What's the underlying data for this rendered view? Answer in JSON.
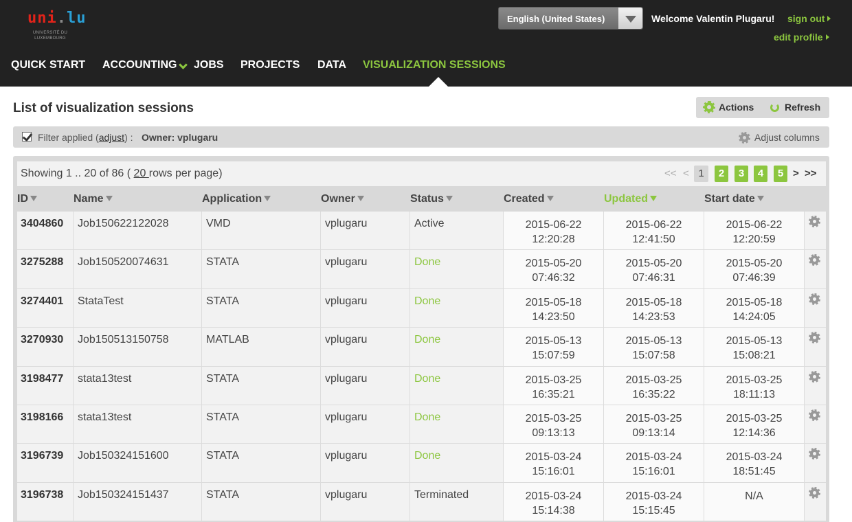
{
  "header": {
    "logo": {
      "word_uni": "uni",
      "word_dot": ".",
      "word_lu": "lu",
      "subtitle": "UNIVERSITÉ DU LUXEMBOURG"
    },
    "language": "English (United States)",
    "welcome": "Welcome Valentin Plugaru!",
    "sign_out": "sign out",
    "edit_profile": "edit profile"
  },
  "nav": {
    "items": [
      "QUICK START",
      "ACCOUNTING",
      "JOBS",
      "PROJECTS",
      "DATA",
      "VISUALIZATION SESSIONS"
    ],
    "active": "VISUALIZATION SESSIONS"
  },
  "page": {
    "title": "List of visualization sessions",
    "actions_label": "Actions",
    "refresh_label": "Refresh"
  },
  "filter": {
    "prefix": "Filter applied (",
    "adjust_link": "adjust",
    "suffix": ") :",
    "owner": "Owner: vplugaru",
    "adjust_columns": "Adjust columns"
  },
  "table": {
    "showing_prefix": "Showing 1 .. 20 of 86 ( ",
    "rows_per_page": "20 ",
    "showing_suffix": "rows per page)",
    "pager": {
      "first": "<<",
      "prev": "<",
      "current": "1",
      "pages": [
        "2",
        "3",
        "4",
        "5"
      ],
      "next": ">",
      "last": ">>"
    },
    "columns": [
      "ID",
      "Name",
      "Application",
      "Owner",
      "Status",
      "Created",
      "Updated",
      "Start date"
    ],
    "sorted_column": "Updated",
    "rows": [
      {
        "id": "3404860",
        "name": "Job150622122028",
        "app": "VMD",
        "owner": "vplugaru",
        "status": "Active",
        "created": [
          "2015-06-22",
          "12:20:28"
        ],
        "updated": [
          "2015-06-22",
          "12:41:50"
        ],
        "start": [
          "2015-06-22",
          "12:20:59"
        ]
      },
      {
        "id": "3275288",
        "name": "Job150520074631",
        "app": "STATA",
        "owner": "vplugaru",
        "status": "Done",
        "created": [
          "2015-05-20",
          "07:46:32"
        ],
        "updated": [
          "2015-05-20",
          "07:46:31"
        ],
        "start": [
          "2015-05-20",
          "07:46:39"
        ]
      },
      {
        "id": "3274401",
        "name": "StataTest",
        "app": "STATA",
        "owner": "vplugaru",
        "status": "Done",
        "created": [
          "2015-05-18",
          "14:23:50"
        ],
        "updated": [
          "2015-05-18",
          "14:23:53"
        ],
        "start": [
          "2015-05-18",
          "14:24:05"
        ]
      },
      {
        "id": "3270930",
        "name": "Job150513150758",
        "app": "MATLAB",
        "owner": "vplugaru",
        "status": "Done",
        "created": [
          "2015-05-13",
          "15:07:59"
        ],
        "updated": [
          "2015-05-13",
          "15:07:58"
        ],
        "start": [
          "2015-05-13",
          "15:08:21"
        ]
      },
      {
        "id": "3198477",
        "name": "stata13test",
        "app": "STATA",
        "owner": "vplugaru",
        "status": "Done",
        "created": [
          "2015-03-25",
          "16:35:21"
        ],
        "updated": [
          "2015-03-25",
          "16:35:22"
        ],
        "start": [
          "2015-03-25",
          "18:11:13"
        ]
      },
      {
        "id": "3198166",
        "name": "stata13test",
        "app": "STATA",
        "owner": "vplugaru",
        "status": "Done",
        "created": [
          "2015-03-25",
          "09:13:13"
        ],
        "updated": [
          "2015-03-25",
          "09:13:14"
        ],
        "start": [
          "2015-03-25",
          "12:14:36"
        ]
      },
      {
        "id": "3196739",
        "name": "Job150324151600",
        "app": "STATA",
        "owner": "vplugaru",
        "status": "Done",
        "created": [
          "2015-03-24",
          "15:16:01"
        ],
        "updated": [
          "2015-03-24",
          "15:16:01"
        ],
        "start": [
          "2015-03-24",
          "18:51:45"
        ]
      },
      {
        "id": "3196738",
        "name": "Job150324151437",
        "app": "STATA",
        "owner": "vplugaru",
        "status": "Terminated",
        "created": [
          "2015-03-24",
          "15:14:38"
        ],
        "updated": [
          "2015-03-24",
          "15:15:45"
        ],
        "start": [
          "N/A",
          ""
        ]
      }
    ]
  },
  "colors": {
    "accent": "#8cc63f",
    "header_bg": "#222222",
    "panel_bg": "#d9d9d9",
    "row_bg": "#f2f2f2"
  }
}
